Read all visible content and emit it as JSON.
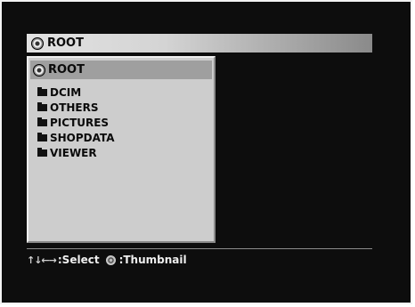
{
  "header": {
    "title": "ROOT",
    "icon": "disc-icon"
  },
  "panel": {
    "root_label": "ROOT",
    "root_icon": "disc-icon",
    "folders": [
      {
        "label": "DCIM",
        "icon": "folder-icon"
      },
      {
        "label": "OTHERS",
        "icon": "folder-icon"
      },
      {
        "label": "PICTURES",
        "icon": "folder-icon"
      },
      {
        "label": "SHOPDATA",
        "icon": "folder-icon"
      },
      {
        "label": "VIEWER",
        "icon": "folder-icon"
      }
    ]
  },
  "footer": {
    "arrows": "↑↓←→",
    "select_label": ":Select",
    "thumbnail_label": ":Thumbnail"
  },
  "colors": {
    "screen_bg": "#0d0d0d",
    "panel_bg": "#cdcdcd",
    "highlight": "#9f9f9f",
    "footer_text": "#efefef"
  }
}
